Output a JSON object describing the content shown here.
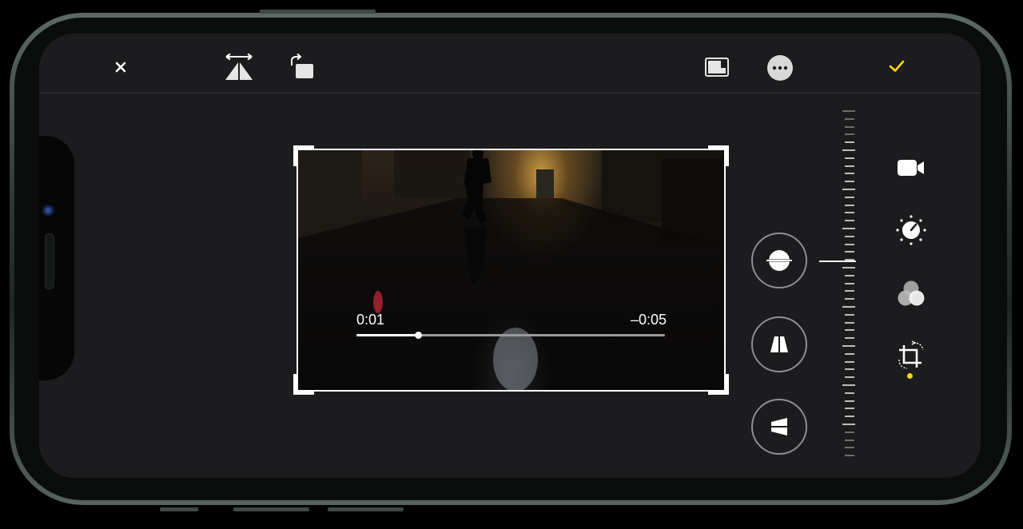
{
  "toolbar": {
    "cancel_icon": "close-icon",
    "flip_icon": "flip-horizontal-icon",
    "rotate_icon": "rotate-icon",
    "aspect_icon": "aspect-ratio-icon",
    "more_icon": "more-icon",
    "done_icon": "checkmark-icon"
  },
  "player": {
    "elapsed": "0:01",
    "remaining": "–0:05",
    "progress": 0.2
  },
  "adjust_tools": [
    {
      "name": "straighten",
      "icon": "straighten-icon"
    },
    {
      "name": "vertical-perspective",
      "icon": "vertical-perspective-icon"
    },
    {
      "name": "horizontal-perspective",
      "icon": "horizontal-perspective-icon"
    }
  ],
  "side_tabs": [
    {
      "name": "video",
      "icon": "video-camera-icon"
    },
    {
      "name": "adjust",
      "icon": "adjust-dial-icon"
    },
    {
      "name": "filters",
      "icon": "filters-icon"
    },
    {
      "name": "crop",
      "icon": "crop-rotate-icon",
      "active": true
    }
  ],
  "colors": {
    "accent": "#ffd60a",
    "background": "#1c1c1e",
    "frame_border": "#ffffff"
  }
}
